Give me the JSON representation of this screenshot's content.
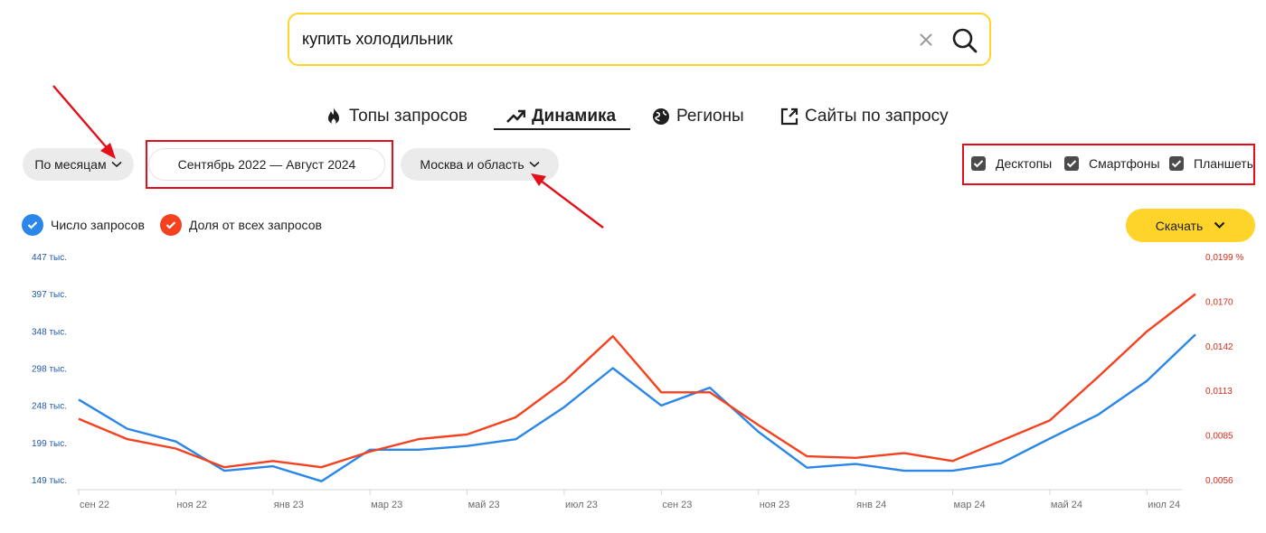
{
  "search": {
    "query": "купить холодильник"
  },
  "tabs": [
    {
      "label": "Топы запросов",
      "icon": "fire-icon"
    },
    {
      "label": "Динамика",
      "icon": "trend-icon",
      "active": true
    },
    {
      "label": "Регионы",
      "icon": "globe-icon"
    },
    {
      "label": "Сайты по запросу",
      "icon": "external-link-icon"
    }
  ],
  "filters": {
    "period": "По месяцам",
    "date_range": "Сентябрь 2022 — Август 2024",
    "region": "Москва и область"
  },
  "devices": [
    {
      "label": "Десктопы",
      "checked": true
    },
    {
      "label": "Смартфоны",
      "checked": true
    },
    {
      "label": "Планшеты",
      "checked": true
    }
  ],
  "legend": [
    {
      "label": "Число запросов",
      "color": "#2a86e8"
    },
    {
      "label": "Доля от всех запросов",
      "color": "#f4411f"
    }
  ],
  "download_label": "Скачать",
  "colors": {
    "accent": "#fed42b",
    "annotation": "#e3101b",
    "left_axis": "#2057a8",
    "right_axis": "#d62c1a"
  },
  "chart_data": {
    "type": "line",
    "x": [
      "сен 22",
      "окт 22",
      "ноя 22",
      "дек 22",
      "янв 23",
      "фев 23",
      "мар 23",
      "апр 23",
      "май 23",
      "июн 23",
      "июл 23",
      "авг 23",
      "сен 23",
      "окт 23",
      "ноя 23",
      "дек 23",
      "янв 24",
      "фев 24",
      "мар 24",
      "апр 24",
      "май 24",
      "июн 24",
      "июл 24",
      "авг 24"
    ],
    "x_tick_labels": [
      "сен 22",
      "ноя 22",
      "янв 23",
      "мар 23",
      "май 23",
      "июл 23",
      "сен 23",
      "ноя 23",
      "янв 24",
      "мар 24",
      "май 24",
      "июл 24"
    ],
    "y_left": {
      "ticks": [
        "447 тыс.",
        "397 тыс.",
        "348 тыс.",
        "298 тыс.",
        "248 тыс.",
        "199 тыс.",
        "149 тыс."
      ],
      "range": [
        149,
        447
      ],
      "unit": "тыс."
    },
    "y_right": {
      "ticks": [
        "0,0199 %",
        "0,0170",
        "0,0142",
        "0,0113",
        "0,0085",
        "0,0056"
      ],
      "range": [
        0.0056,
        0.0199
      ]
    },
    "series": [
      {
        "name": "Число запросов",
        "axis": "left",
        "color": "#2a86e8",
        "values": [
          256,
          217,
          200,
          161,
          167,
          147,
          189,
          189,
          194,
          203,
          246,
          298,
          248,
          272,
          213,
          165,
          170,
          161,
          161,
          171,
          204,
          236,
          281,
          343
        ]
      },
      {
        "name": "Доля от всех запросов",
        "axis": "right",
        "color": "#f4411f",
        "values": [
          0.0095,
          0.0082,
          0.0076,
          0.0064,
          0.0068,
          0.0064,
          0.0074,
          0.0082,
          0.0085,
          0.0096,
          0.0119,
          0.0148,
          0.0112,
          0.0112,
          0.0091,
          0.0071,
          0.007,
          0.0073,
          0.0068,
          0.0081,
          0.0094,
          0.0122,
          0.0151,
          0.0175
        ]
      }
    ],
    "grid": false
  }
}
